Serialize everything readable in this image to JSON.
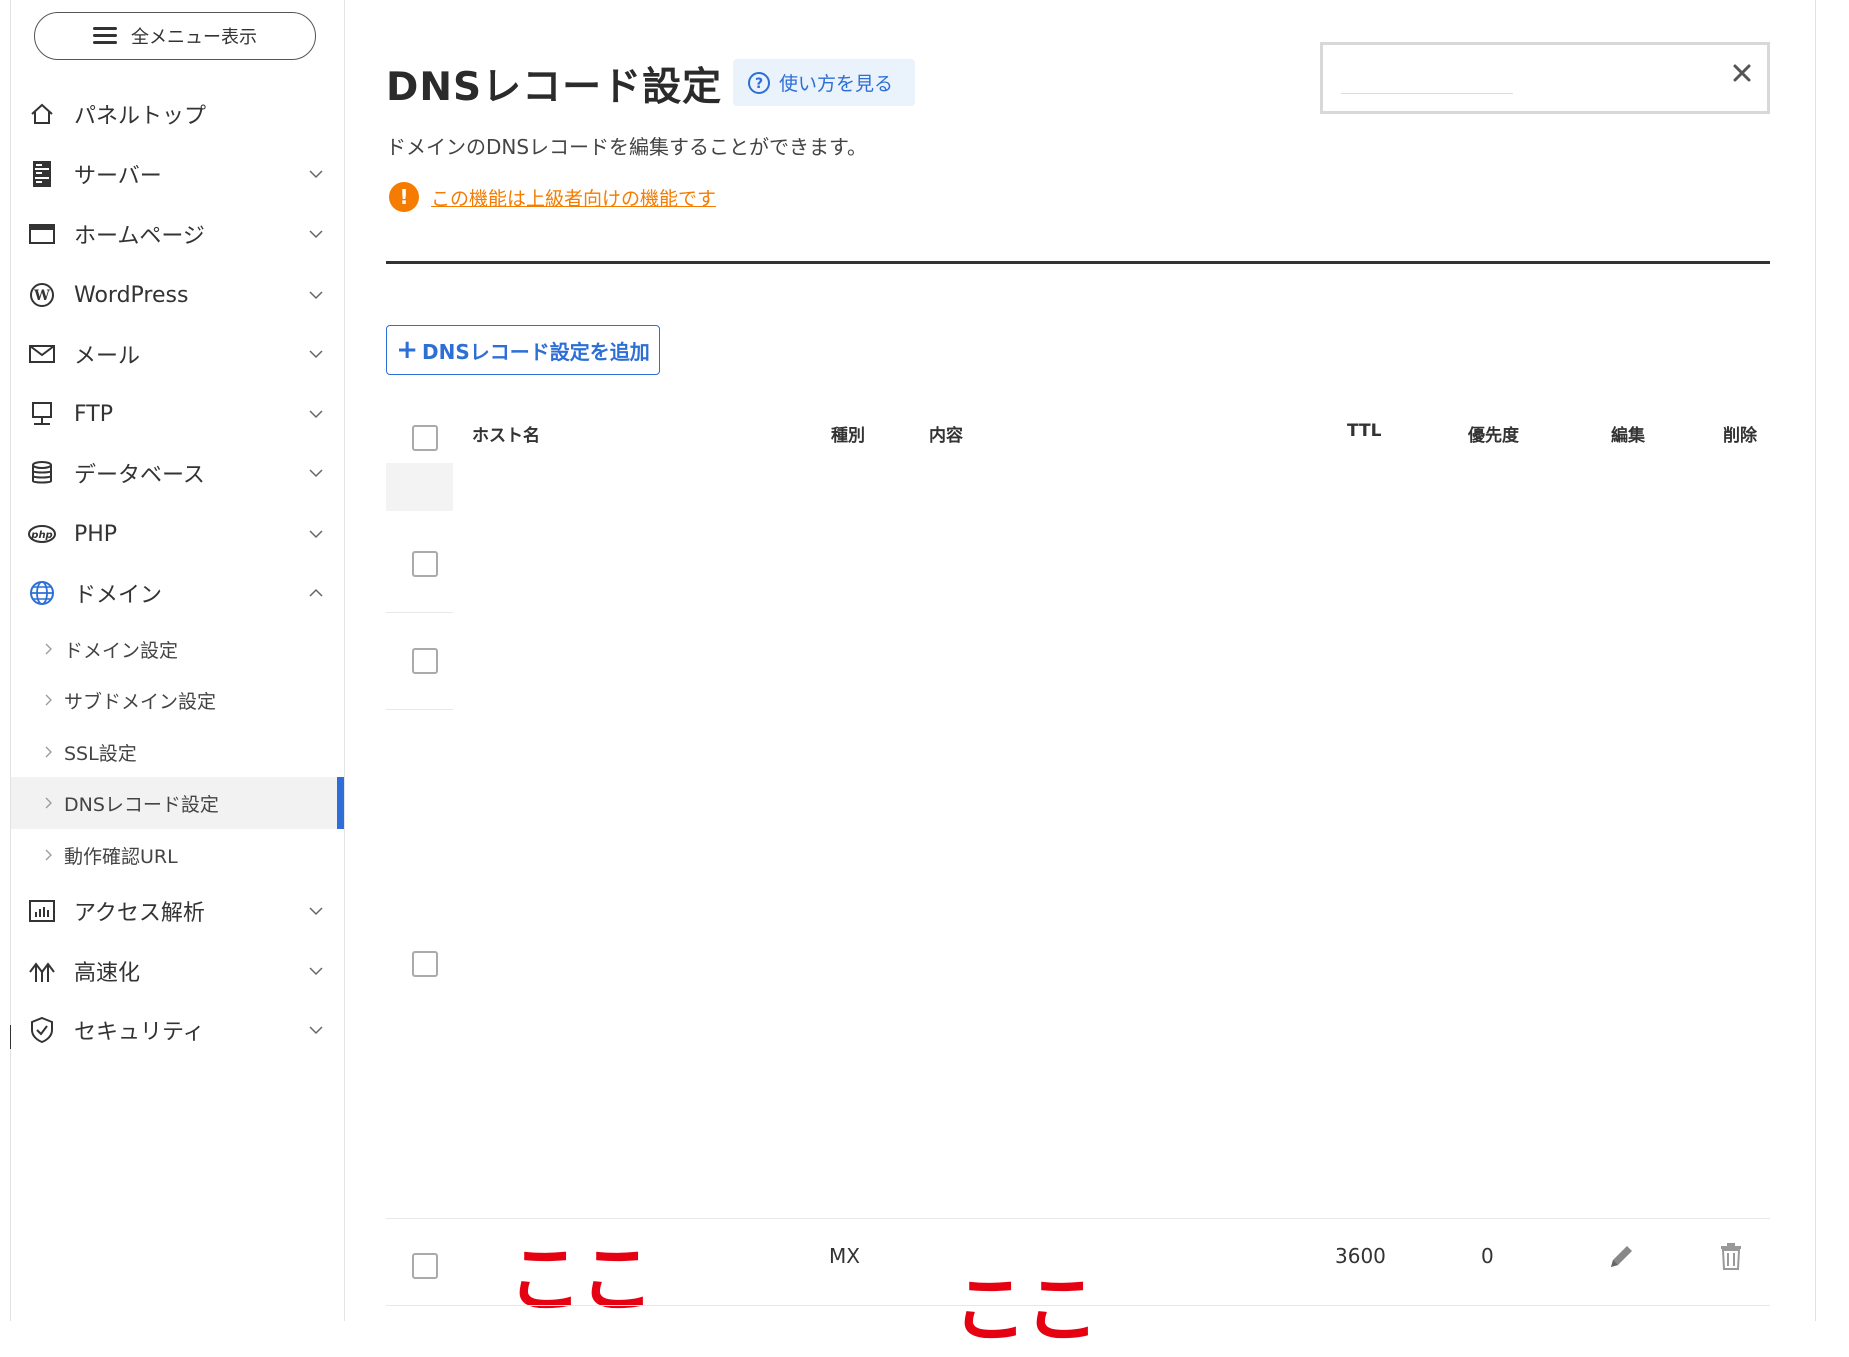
{
  "sidebar": {
    "menu_button": "全メニュー表示",
    "items": [
      {
        "label": "パネルトップ",
        "icon": "home-icon"
      },
      {
        "label": "サーバー",
        "icon": "server-icon"
      },
      {
        "label": "ホームページ",
        "icon": "browser-window-icon"
      },
      {
        "label": "WordPress",
        "icon": "wordpress-icon"
      },
      {
        "label": "メール",
        "icon": "mail-icon"
      },
      {
        "label": "FTP",
        "icon": "ftp-monitor-icon"
      },
      {
        "label": "データベース",
        "icon": "database-icon"
      },
      {
        "label": "PHP",
        "icon": "php-icon"
      },
      {
        "label": "ドメイン",
        "icon": "globe-icon"
      },
      {
        "label": "アクセス解析",
        "icon": "chart-icon"
      },
      {
        "label": "高速化",
        "icon": "speed-icon"
      },
      {
        "label": "セキュリティ",
        "icon": "shield-icon"
      }
    ],
    "sub_items": [
      "ドメイン設定",
      "サブドメイン設定",
      "SSL設定",
      "DNSレコード設定",
      "動作確認URL"
    ],
    "active_sub_item": "DNSレコード設定",
    "accent_color": "#2d6fd6"
  },
  "header": {
    "title": "DNSレコード設定",
    "help_label": "使い方を見る",
    "description": "ドメインのDNSレコードを編集することができます。",
    "warning_link": "この機能は上級者向けの機能です",
    "warning_color": "#f57c00"
  },
  "search": {
    "value": "",
    "placeholder": ""
  },
  "actions": {
    "add_button": "DNSレコード設定を追加",
    "add_prefix": "+"
  },
  "table": {
    "columns": [
      "ホスト名",
      "種別",
      "内容",
      "TTL",
      "優先度",
      "編集",
      "削除"
    ],
    "last_row": {
      "host": "ここ",
      "type": "MX",
      "content": "ここ",
      "ttl": "3600",
      "priority": "0"
    }
  }
}
